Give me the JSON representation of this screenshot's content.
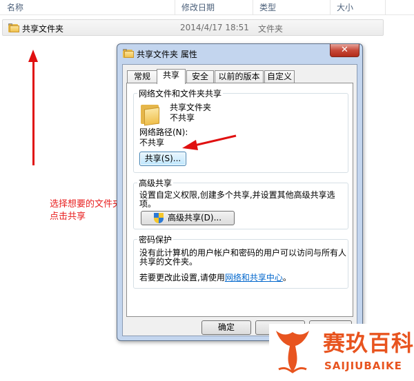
{
  "explorer": {
    "columns": {
      "name": "名称",
      "modified": "修改日期",
      "type": "类型",
      "size": "大小"
    },
    "rows": [
      {
        "name": "共享文件夹",
        "modified": "2014/4/17 18:51",
        "type": "文件夹",
        "icon": "folder-icon"
      }
    ]
  },
  "annotation": {
    "line1": "选择想要的文件夹,右键属性",
    "line2": "点击共享",
    "color": "#e82020"
  },
  "dialog": {
    "title": "共享文件夹 属性",
    "close_label": "✕",
    "tabs": [
      {
        "label": "常规",
        "active": false
      },
      {
        "label": "共享",
        "active": true
      },
      {
        "label": "安全",
        "active": false
      },
      {
        "label": "以前的版本",
        "active": false
      },
      {
        "label": "自定义",
        "active": false
      }
    ],
    "network_share": {
      "group_title": "网络文件和文件夹共享",
      "folder_name": "共享文件夹",
      "status": "不共享",
      "path_label": "网络路径(N):",
      "path_value": "不共享",
      "share_button": "共享(S)..."
    },
    "advanced_share": {
      "group_title": "高级共享",
      "description_line1": "设置自定义权限,创建多个共享,并设置其他高级共享选",
      "description_line2": "项。",
      "button": "高级共享(D)..."
    },
    "password": {
      "group_title": "密码保护",
      "description_line1": "没有此计算机的用户帐户和密码的用户可以访问与所有人",
      "description_line2": "共享的文件夹。",
      "change_prefix": "若要更改此设置,请使用",
      "change_link": "网络和共享中心",
      "change_suffix": "。"
    },
    "ok_button": "确定"
  },
  "watermark": {
    "brand_cn": "赛玖百科",
    "brand_en": "SAIJIUBAIKE",
    "color": "#e8541f"
  }
}
